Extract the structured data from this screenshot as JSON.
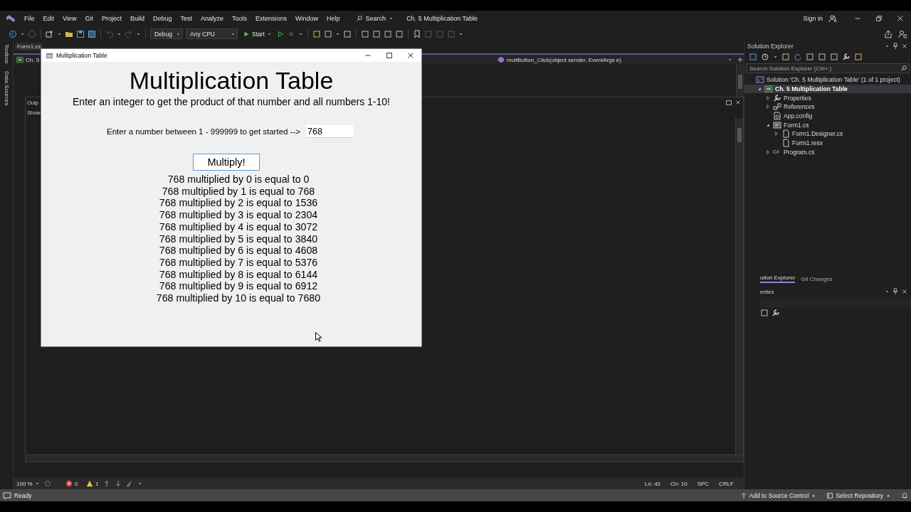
{
  "menu": [
    "File",
    "Edit",
    "View",
    "Git",
    "Project",
    "Build",
    "Debug",
    "Test",
    "Analyze",
    "Tools",
    "Extensions",
    "Window",
    "Help"
  ],
  "search": "Search",
  "solution_title": "Ch. 5 Multiplication Table",
  "sign_in": "Sign in",
  "toolbar": {
    "configuration": "Debug",
    "platform": "Any CPU",
    "start": "Start"
  },
  "side_tabs": [
    "Toolbox",
    "Data Sources"
  ],
  "editor": {
    "tab": "Form1.cs",
    "project_dropdown": "Ch. 5",
    "method_dropdown": "multButton_Click(object sender, EventArgs e)"
  },
  "output": {
    "title": "Outp",
    "show_label": "Show"
  },
  "editor_status": {
    "zoom": "100 %",
    "errors": "0",
    "warnings": "1",
    "line": "Ln: 42",
    "column": "Ch: 10",
    "whitespace": "SPC",
    "line_ending": "CRLF"
  },
  "solution_explorer": {
    "title": "Solution Explorer",
    "search_placeholder": "Search Solution Explorer (Ctrl+;)",
    "tree": [
      {
        "label": "Solution 'Ch. 5 Multiplication Table' (1 of 1 project)",
        "kind": "solution",
        "children": [
          {
            "label": "Ch. 5 Multiplication Table",
            "kind": "project",
            "expanded": true,
            "selected": true,
            "children": [
              {
                "label": "Properties",
                "kind": "wrench",
                "expanded": false,
                "selected": false
              },
              {
                "label": "References",
                "kind": "references",
                "expanded": false,
                "selected": false
              },
              {
                "label": "App.config",
                "kind": "config",
                "selected": false
              },
              {
                "label": "Form1.cs",
                "kind": "form",
                "expanded": true,
                "selected": false,
                "children": [
                  {
                    "label": "Form1.Designer.cs",
                    "kind": "file",
                    "expanded": false,
                    "selected": false
                  },
                  {
                    "label": "Form1.resx",
                    "kind": "file",
                    "selected": false
                  }
                ]
              },
              {
                "label": "Program.cs",
                "kind": "csharp",
                "icon_text": "C#",
                "expanded": false,
                "selected": false
              }
            ]
          }
        ]
      }
    ]
  },
  "panel_tabs": [
    {
      "label": "ution Explorer",
      "selected": true
    },
    {
      "label": "Git Changes",
      "selected": false
    }
  ],
  "properties": {
    "title": "erties"
  },
  "status_bar": {
    "status": "Ready",
    "source_control": "Add to Source Control",
    "repository": "Select Repository"
  },
  "dialog": {
    "title": "Multiplication Table",
    "heading": "Multiplication Table",
    "instructions": "Enter an integer to get the product of that number and all numbers 1-10!",
    "prompt": "Enter a number between 1 - 999999 to get started -->",
    "value": "768",
    "button": "Multiply!",
    "results": [
      "768 multiplied by 0 is equal to 0",
      "768 multiplied by 1 is equal to 768",
      "768 multiplied by 2 is equal to 1536",
      "768 multiplied by 3 is equal to 2304",
      "768 multiplied by 4 is equal to 3072",
      "768 multiplied by 5 is equal to 3840",
      "768 multiplied by 6 is equal to 4608",
      "768 multiplied by 7 is equal to 5376",
      "768 multiplied by 8 is equal to 6144",
      "768 multiplied by 9 is equal to 6912",
      "768 multiplied by 10 is equal to 7680"
    ]
  }
}
